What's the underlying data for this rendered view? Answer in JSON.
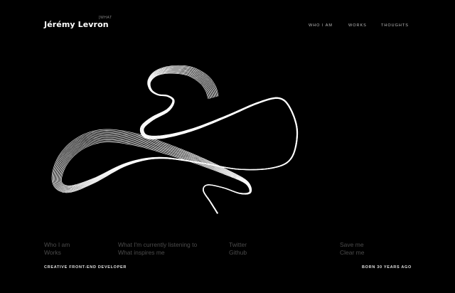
{
  "header": {
    "brand": "Jérémy Levron",
    "brand_tag": "[WHAT",
    "nav": [
      "WHO I AM",
      "WORKS",
      "THOUGHTS"
    ]
  },
  "footer": {
    "columns": [
      [
        "Who I am",
        "Works"
      ],
      [
        "What I'm currently listening to",
        "What inspires me"
      ],
      [
        "Twitter",
        "Github"
      ],
      [
        "Save me",
        "Clear me"
      ]
    ],
    "tagline": "CREATIVE FRONT-END DEVELOPER",
    "born": "BORN 30 YEARS AGO"
  },
  "colors": {
    "background": "#000000",
    "text": "#ffffff",
    "muted": "#4b4b4b",
    "nav": "#bdbdbd"
  },
  "art": {
    "description_icon": "ribbon-line-sculpture"
  }
}
